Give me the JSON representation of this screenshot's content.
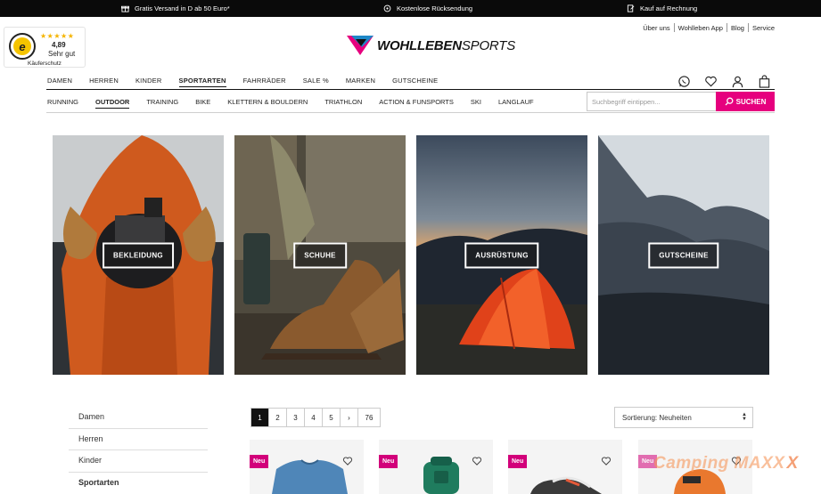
{
  "topbar": {
    "usp1": "Gratis Versand in D ab 50 Euro*",
    "usp2": "Kostenlose Rücksendung",
    "usp3": "Kauf auf Rechnung"
  },
  "trusted_shops": {
    "score": "4,89",
    "rating": "Sehr gut",
    "label": "Käuferschutz"
  },
  "brand": {
    "logo": "WOHLLEBENSPORTS",
    "logo_bold": "WOHLLEBEN",
    "logo_light": "SPORTS"
  },
  "toplinks": [
    "Über uns",
    "Wohlleben App",
    "Blog",
    "Service"
  ],
  "main_nav": [
    "DAMEN",
    "HERREN",
    "KINDER",
    "SPORTARTEN",
    "FAHRRÄDER",
    "SALE %",
    "MARKEN",
    "GUTSCHEINE"
  ],
  "sub_nav": [
    "RUNNING",
    "OUTDOOR",
    "TRAINING",
    "BIKE",
    "KLETTERN & BOULDERN",
    "TRIATHLON",
    "ACTION & FUNSPORTS",
    "SKI",
    "LANGLAUF"
  ],
  "header_icons": [
    "whatsapp-icon",
    "heart-icon",
    "user-icon",
    "bag-icon"
  ],
  "search": {
    "placeholder": "Suchbegriff eintippen...",
    "button_label": "SUCHEN"
  },
  "tiles": [
    "BEKLEIDUNG",
    "SCHUHE",
    "AUSRÜSTUNG",
    "GUTSCHEINE"
  ],
  "sidebar": [
    "Damen",
    "Herren",
    "Kinder",
    "Sportarten"
  ],
  "pagination": [
    "1",
    "2",
    "3",
    "4",
    "5",
    "›",
    "76"
  ],
  "sort": {
    "value": "Sortierung: Neuheiten"
  },
  "products": [
    {
      "badge": "Neu"
    },
    {
      "badge": "Neu"
    },
    {
      "badge": "Neu"
    },
    {
      "badge": "Neu"
    }
  ],
  "watermark": {
    "text": "Camping MAXX",
    "mark": "X"
  },
  "colors": {
    "accent": "#e6007e",
    "topbar": "#0a0a0a",
    "badge": "#d2007a"
  }
}
